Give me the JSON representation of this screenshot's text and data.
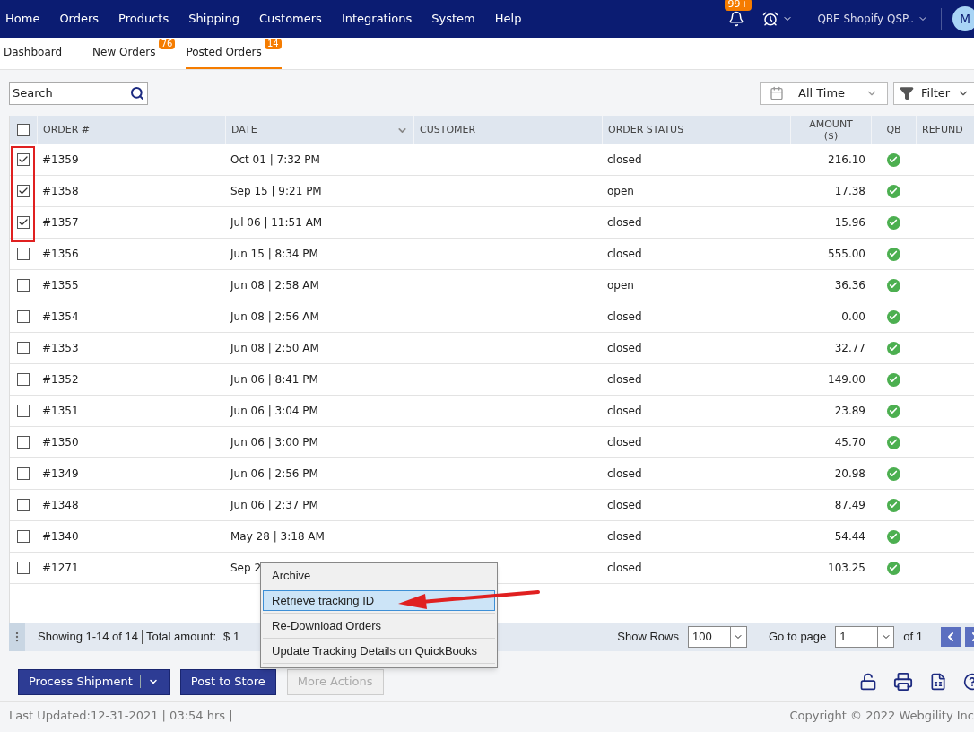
{
  "nav": {
    "items": [
      "Home",
      "Orders",
      "Products",
      "Shipping",
      "Customers",
      "Integrations",
      "System",
      "Help"
    ],
    "notifications_badge": "99+",
    "store": "QBE Shopify QSP..",
    "avatar": "M"
  },
  "tabs": [
    {
      "label": "Dashboard",
      "selected": false
    },
    {
      "label": "New Orders",
      "count": "76",
      "selected": false
    },
    {
      "label": "Posted Orders",
      "count": "14",
      "selected": true
    }
  ],
  "search": {
    "placeholder": "Search"
  },
  "date_filter": "All Time",
  "filter_button": "Filter",
  "table": {
    "header_checked": false,
    "columns": [
      "ORDER #",
      "DATE",
      "CUSTOMER",
      "ORDER STATUS",
      "AMOUNT ($)",
      "QB",
      "REFUND"
    ],
    "rows": [
      {
        "checked": true,
        "order": "#1359",
        "date": "Oct 01 | 7:32 PM",
        "status": "closed",
        "amount": "216.10",
        "qb_posted": true
      },
      {
        "checked": true,
        "order": "#1358",
        "date": "Sep 15 | 9:21 PM",
        "status": "open",
        "amount": "17.38",
        "qb_posted": true
      },
      {
        "checked": true,
        "order": "#1357",
        "date": "Jul 06 | 11:51 AM",
        "status": "closed",
        "amount": "15.96",
        "qb_posted": true
      },
      {
        "checked": false,
        "order": "#1356",
        "date": "Jun 15 | 8:34 PM",
        "status": "closed",
        "amount": "555.00",
        "qb_posted": true
      },
      {
        "checked": false,
        "order": "#1355",
        "date": "Jun 08 | 2:58 AM",
        "status": "open",
        "amount": "36.36",
        "qb_posted": true
      },
      {
        "checked": false,
        "order": "#1354",
        "date": "Jun 08 | 2:56 AM",
        "status": "closed",
        "amount": "0.00",
        "qb_posted": true
      },
      {
        "checked": false,
        "order": "#1353",
        "date": "Jun 08 | 2:50 AM",
        "status": "closed",
        "amount": "32.77",
        "qb_posted": true
      },
      {
        "checked": false,
        "order": "#1352",
        "date": "Jun 06 | 8:41 PM",
        "status": "closed",
        "amount": "149.00",
        "qb_posted": true
      },
      {
        "checked": false,
        "order": "#1351",
        "date": "Jun 06 | 3:04 PM",
        "status": "closed",
        "amount": "23.89",
        "qb_posted": true
      },
      {
        "checked": false,
        "order": "#1350",
        "date": "Jun 06 | 3:00 PM",
        "status": "closed",
        "amount": "45.70",
        "qb_posted": true
      },
      {
        "checked": false,
        "order": "#1349",
        "date": "Jun 06 | 2:56 PM",
        "status": "closed",
        "amount": "20.98",
        "qb_posted": true
      },
      {
        "checked": false,
        "order": "#1348",
        "date": "Jun 06 | 2:37 PM",
        "status": "closed",
        "amount": "87.49",
        "qb_posted": true
      },
      {
        "checked": false,
        "order": "#1340",
        "date": "May 28 | 3:18 AM",
        "status": "closed",
        "amount": "54.44",
        "qb_posted": true
      },
      {
        "checked": false,
        "order": "#1271",
        "date": "Sep 2",
        "status": "closed",
        "amount": "103.25",
        "qb_posted": true
      }
    ]
  },
  "pager": {
    "summary": "Showing 1-14 of 14",
    "total_label": "Total amount:",
    "total_value": "$ 1",
    "show_rows_label": "Show Rows",
    "rows_value": "100",
    "goto_label": "Go to page",
    "page_value": "1",
    "of_label": "of 1"
  },
  "actions": [
    {
      "kind": "split",
      "label": "Process Shipment"
    },
    {
      "kind": "primary",
      "label": "Post to Store"
    },
    {
      "kind": "secondary",
      "label": "More Actions"
    }
  ],
  "context_menu": [
    {
      "label": "Archive",
      "selected": false
    },
    {
      "label": "Retrieve tracking ID",
      "selected": true
    },
    {
      "label": "Re-Download Orders",
      "selected": false
    },
    {
      "label": "Update Tracking Details on QuickBooks",
      "selected": false
    }
  ],
  "footer": {
    "last_updated": "Last Updated:12-31-2021 | 03:54 hrs |",
    "copyright": "Copyright © 2022 Webgility Inc"
  }
}
